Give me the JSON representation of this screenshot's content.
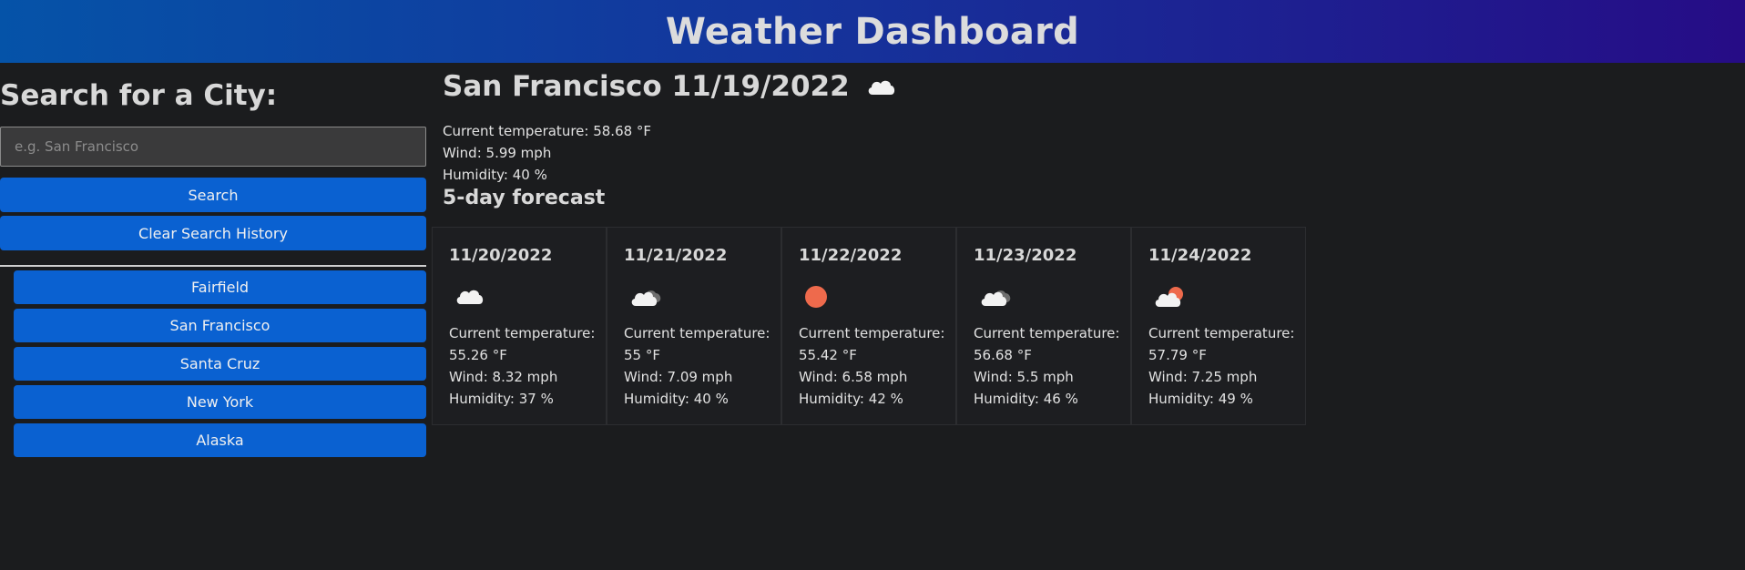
{
  "header": {
    "title": "Weather Dashboard"
  },
  "sidebar": {
    "heading": "Search for a City:",
    "search_placeholder": "e.g. San Francisco",
    "search_value": "",
    "search_label": "Search",
    "clear_label": "Clear Search History",
    "history": [
      "Fairfield",
      "San Francisco",
      "Santa Cruz",
      "New York",
      "Alaska"
    ]
  },
  "current": {
    "city_date": "San Francisco 11/19/2022",
    "icon": "cloud-icon",
    "temp": "Current temperature: 58.68 °F",
    "wind": "Wind: 5.99 mph",
    "humidity": "Humidity: 40 %"
  },
  "forecast": {
    "heading": "5-day forecast",
    "days": [
      {
        "date": "11/20/2022",
        "icon": "cloud-icon",
        "temp_label": "Current temperature:",
        "temp": "55.26 °F",
        "wind": "Wind: 8.32 mph",
        "humidity": "Humidity: 37 %"
      },
      {
        "date": "11/21/2022",
        "icon": "broken-clouds-icon",
        "temp_label": "Current temperature:",
        "temp": "55 °F",
        "wind": "Wind: 7.09 mph",
        "humidity": "Humidity: 40 %"
      },
      {
        "date": "11/22/2022",
        "icon": "sun-icon",
        "temp_label": "Current temperature:",
        "temp": "55.42 °F",
        "wind": "Wind: 6.58 mph",
        "humidity": "Humidity: 42 %"
      },
      {
        "date": "11/23/2022",
        "icon": "broken-clouds-icon",
        "temp_label": "Current temperature:",
        "temp": "56.68 °F",
        "wind": "Wind: 5.5 mph",
        "humidity": "Humidity: 46 %"
      },
      {
        "date": "11/24/2022",
        "icon": "partly-cloudy-icon",
        "temp_label": "Current temperature:",
        "temp": "57.79 °F",
        "wind": "Wind: 7.25 mph",
        "humidity": "Humidity: 49 %"
      }
    ]
  },
  "colors": {
    "background": "#1b1c1e",
    "button": "#0a61d1",
    "sun": "#ee6a4c",
    "cloud": "#f2f2f2",
    "dark_cloud": "#6e6e6e"
  }
}
